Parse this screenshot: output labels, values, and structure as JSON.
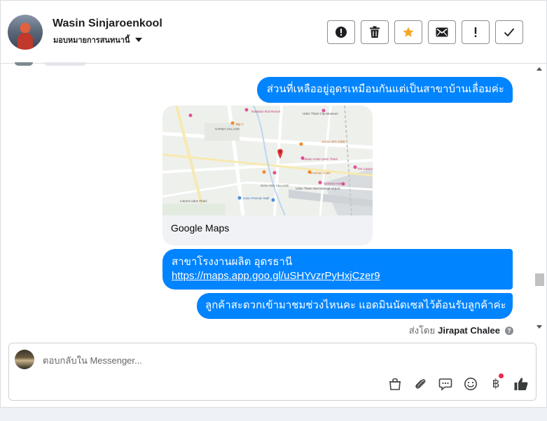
{
  "header": {
    "contact_name": "Wasin Sinjaroenkool",
    "assign_label": "มอบหมายการสนทนานี้",
    "tools": [
      {
        "icon": "alert-circle-icon",
        "label": "spam"
      },
      {
        "icon": "trash-icon",
        "label": "delete"
      },
      {
        "icon": "star-icon",
        "label": "follow-up"
      },
      {
        "icon": "envelope-icon",
        "label": "mark-unread"
      },
      {
        "icon": "exclamation-icon",
        "label": "important"
      },
      {
        "icon": "check-icon",
        "label": "done"
      }
    ]
  },
  "messages": {
    "msg1": "ส่วนที่เหลืออยู่อุดรเหมือนกันแต่เป็นสาขาบ้านเลื่อมค่ะ",
    "map_card": {
      "title": "Google Maps",
      "labels": [
        "Nakakan Rail Resort",
        "Udon Thani City Museum",
        "HARBA VILLAGE",
        "Big C",
        "KASA SPA SIDE",
        "Kitlado Hotel Udon Thani",
        "Udon Thani International Airport",
        "Lotus's Udon Thani",
        "NON YEN VILLAGE",
        "Udon Premier Mall",
        "Tim Catering",
        "Premier Hotel",
        "Centara Hotel"
      ]
    },
    "msg2_line1": "สาขาโรงงานผลิต อุดรธานี",
    "msg2_link": "https://maps.app.goo.gl/uSHYvzrPyHxjCzer9",
    "msg3": "ลูกค้าสะดวกเข้ามาชมช่วงไหนคะ แอดมินนัดเซลไว้ต้อนรับลูกค้าค่ะ",
    "sent_by_prefix": "ส่งโดย",
    "sent_by_name": "Jirapat Chalee",
    "help_glyph": "?"
  },
  "composer": {
    "placeholder": "ตอบกลับใน Messenger...",
    "icons": [
      "bag-icon",
      "paperclip-icon",
      "chat-bubble-icon",
      "smiley-icon",
      "baht-icon",
      "thumbs-up-icon"
    ],
    "baht_glyph": "฿"
  },
  "colors": {
    "bubble": "#0084ff",
    "accent_star": "#f5a623",
    "notify_dot": "#f02849"
  }
}
